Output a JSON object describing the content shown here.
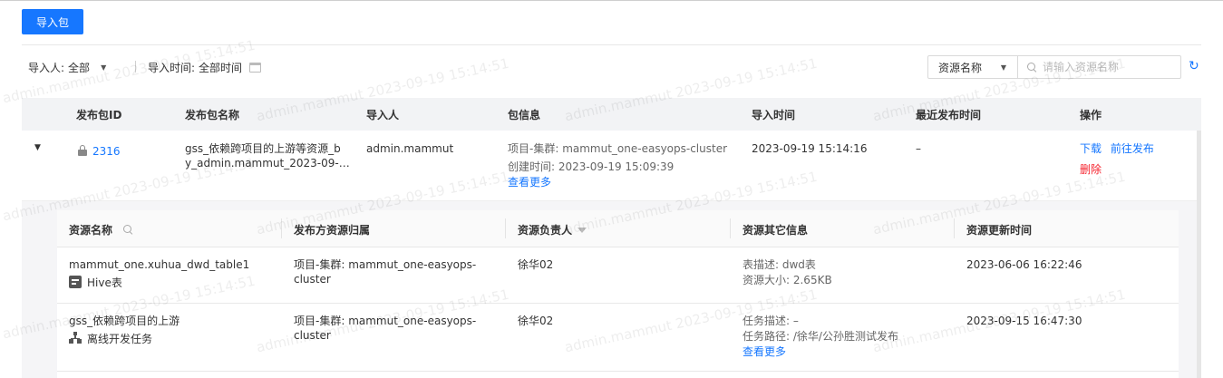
{
  "toolbar": {
    "import_button": "导入包"
  },
  "filters": {
    "importer_label": "导入人:",
    "importer_value": "全部",
    "import_time_label": "导入时间:",
    "import_time_value": "全部时间"
  },
  "search": {
    "field_select": "资源名称",
    "placeholder": "请输入资源名称"
  },
  "table": {
    "headers": [
      "发布包ID",
      "发布包名称",
      "导入人",
      "包信息",
      "导入时间",
      "最近发布时间",
      "操作"
    ],
    "rows": [
      {
        "id": "2316",
        "name_line1": "gss_依赖跨项目的上游等资源_b",
        "name_line2": "y_admin.mammut_2023-09-…",
        "importer": "admin.mammut",
        "info_line1": "项目-集群: mammut_one-easyops-cluster",
        "info_line2": "创建时间: 2023-09-19 15:09:39",
        "info_more": "查看更多",
        "import_time": "2023-09-19 15:14:16",
        "last_publish": "–",
        "actions": {
          "download": "下载",
          "publish": "前往发布",
          "delete": "删除"
        }
      }
    ]
  },
  "subtable": {
    "headers": [
      "资源名称",
      "发布方资源归属",
      "资源负责人",
      "资源其它信息",
      "资源更新时间"
    ],
    "rows": [
      {
        "name": "mammut_one.xuhua_dwd_table1",
        "type": "Hive表",
        "type_icon": "table-icon",
        "belong_line1": "项目-集群:  mammut_one-easyops-",
        "belong_line2": "cluster",
        "owner": "徐华02",
        "other_line1": "表描述: dwd表",
        "other_line2": "资源大小: 2.65KB",
        "other_more": "",
        "update_time": "2023-06-06 16:22:46"
      },
      {
        "name": "gss_依赖跨项目的上游",
        "type": "离线开发任务",
        "type_icon": "tree-icon",
        "belong_line1": "项目-集群:  mammut_one-easyops-",
        "belong_line2": "cluster",
        "owner": "徐华02",
        "other_line1": "任务描述: –",
        "other_line2": "任务路径: /徐华/公孙胜测试发布",
        "other_more": "查看更多",
        "update_time": "2023-09-15 16:47:30"
      }
    ]
  },
  "watermark": {
    "text": "admin.mammut 2023-09-19 15:14:51"
  },
  "colors": {
    "primary": "#1677ff",
    "danger": "#f5222d",
    "header_bg": "#f2f3f5"
  }
}
